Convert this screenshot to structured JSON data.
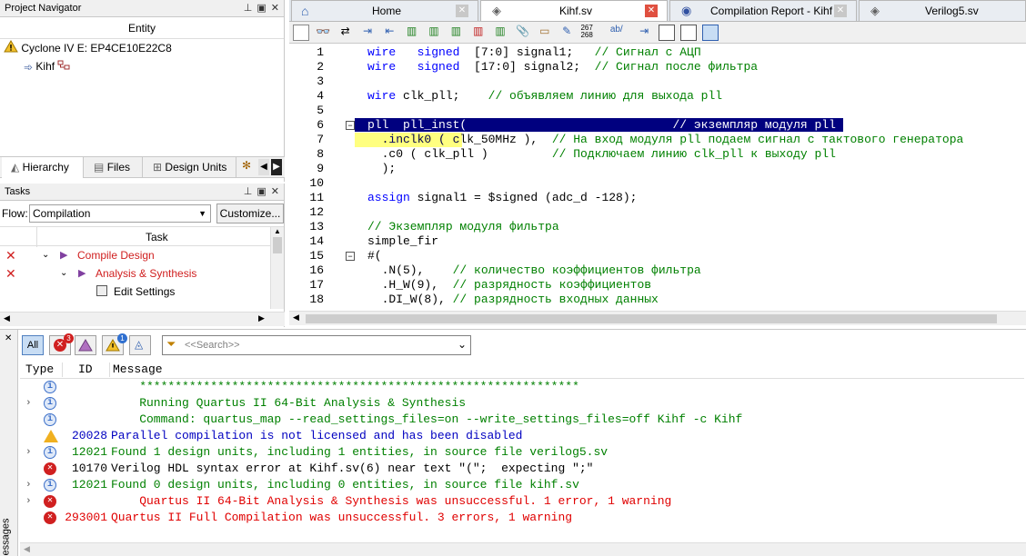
{
  "project_navigator": {
    "title": "Project Navigator",
    "column": "Entity",
    "device": "Cyclone IV E: EP4CE10E22C8",
    "top_entity": "Kihf",
    "tabs": [
      "Hierarchy",
      "Files",
      "Design Units"
    ]
  },
  "tasks": {
    "title": "Tasks",
    "flow_label": "Flow:",
    "flow_value": "Compilation",
    "customize_label": "Customize...",
    "column": "Task",
    "items": [
      {
        "label": "Compile Design",
        "level": 0
      },
      {
        "label": "Analysis & Synthesis",
        "level": 1
      },
      {
        "label": "Edit Settings",
        "level": 2
      }
    ]
  },
  "editor_tabs": [
    {
      "label": "Home"
    },
    {
      "label": "Kihf.sv"
    },
    {
      "label": "Compilation Report - Kihf"
    },
    {
      "label": "Verilog5.sv"
    }
  ],
  "toolbar": {
    "number_top": "267",
    "number_bottom": "268",
    "ab_label": "ab/"
  },
  "code": {
    "lines": [
      {
        "n": "1",
        "segs": [
          [
            "kw",
            "wire   signed  "
          ],
          [
            "num",
            "[7:0] signal1;   "
          ],
          [
            "cm",
            "// Сигнал с АЦП"
          ]
        ]
      },
      {
        "n": "2",
        "segs": [
          [
            "kw",
            "wire   signed  "
          ],
          [
            "num",
            "[17:0] signal2;  "
          ],
          [
            "cm",
            "// Сигнал после фильтра"
          ]
        ]
      },
      {
        "n": "3",
        "segs": []
      },
      {
        "n": "4",
        "segs": [
          [
            "kw",
            "wire "
          ],
          [
            "num",
            "clk_pll;    "
          ],
          [
            "cm",
            "// объявляем линию для выхода pll"
          ]
        ]
      },
      {
        "n": "5",
        "segs": []
      },
      {
        "n": "6",
        "segs": [
          [
            "sel",
            "pll  pll_inst(                             // экземпляр модуля pll "
          ]
        ]
      },
      {
        "n": "7",
        "segs": [
          [
            "num",
            "  .inclk0 ( clk_50MHz ),  "
          ],
          [
            "cm",
            "// На вход модуля pll подаем сигнал с тактового генератора"
          ]
        ]
      },
      {
        "n": "8",
        "segs": [
          [
            "num",
            "  .c0 ( clk_pll )         "
          ],
          [
            "cm",
            "// Подключаем линию clk_pll к выходу pll"
          ]
        ]
      },
      {
        "n": "9",
        "segs": [
          [
            "num",
            "  );"
          ]
        ]
      },
      {
        "n": "10",
        "segs": []
      },
      {
        "n": "11",
        "segs": [
          [
            "kw",
            "assign "
          ],
          [
            "num",
            "signal1 = $signed (adc_d -128);"
          ]
        ]
      },
      {
        "n": "12",
        "segs": []
      },
      {
        "n": "13",
        "segs": [
          [
            "cm",
            "// Экземпляр модуля фильтра"
          ]
        ]
      },
      {
        "n": "14",
        "segs": [
          [
            "num",
            "simple_fir"
          ]
        ]
      },
      {
        "n": "15",
        "segs": [
          [
            "num",
            "#("
          ]
        ]
      },
      {
        "n": "16",
        "segs": [
          [
            "num",
            "  .N(5),    "
          ],
          [
            "cm",
            "// количество коэффициентов фильтра"
          ]
        ]
      },
      {
        "n": "17",
        "segs": [
          [
            "num",
            "  .H_W(9),  "
          ],
          [
            "cm",
            "// разрядность коэффициентов"
          ]
        ]
      },
      {
        "n": "18",
        "segs": [
          [
            "num",
            "  .DI_W(8), "
          ],
          [
            "cm",
            "// разрядность входных данных"
          ]
        ]
      }
    ]
  },
  "messages": {
    "filter_all": "All",
    "error_count": "3",
    "info_count": "1",
    "search_placeholder": "<<Search>>",
    "side_label": "essages",
    "columns": [
      "Type",
      "ID",
      "Message"
    ],
    "rows": [
      {
        "type": "info",
        "id": "",
        "text": "    **************************************************************",
        "color": "#008000",
        "expander": false
      },
      {
        "type": "info",
        "id": "",
        "text": "    Running Quartus II 64-Bit Analysis & Synthesis",
        "color": "#008000",
        "expander": true
      },
      {
        "type": "info",
        "id": "",
        "text": "    Command: quartus_map --read_settings_files=on --write_settings_files=off Kihf -c Kihf",
        "color": "#008000",
        "expander": false
      },
      {
        "type": "warning",
        "id": "20028",
        "text": "Parallel compilation is not licensed and has been disabled",
        "color": "#0000c0",
        "expander": false
      },
      {
        "type": "info",
        "id": "12021",
        "text": "Found 1 design units, including 1 entities, in source file verilog5.sv",
        "color": "#008000",
        "expander": true
      },
      {
        "type": "error",
        "id": "10170",
        "text": "Verilog HDL syntax error at Kihf.sv(6) near text \"(\";  expecting \";\"",
        "color": "#000000",
        "expander": false
      },
      {
        "type": "info",
        "id": "12021",
        "text": "Found 0 design units, including 0 entities, in source file kihf.sv",
        "color": "#008000",
        "expander": true
      },
      {
        "type": "error",
        "id": "",
        "text": "    Quartus II 64-Bit Analysis & Synthesis was unsuccessful. 1 error, 1 warning",
        "color": "#e00000",
        "expander": true
      },
      {
        "type": "error",
        "id": "293001",
        "text": "Quartus II Full Compilation was unsuccessful. 3 errors, 1 warning",
        "color": "#e00000",
        "expander": false
      }
    ]
  },
  "colors": {
    "selection": "#00007f",
    "info": "#3b6fc9",
    "error": "#d02020",
    "warning": "#f0b020"
  }
}
